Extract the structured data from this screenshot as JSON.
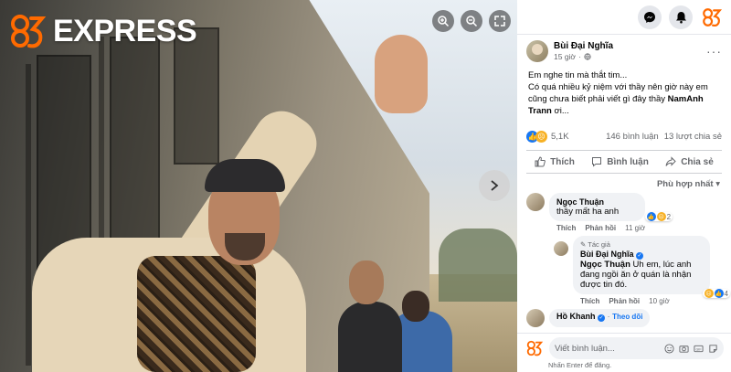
{
  "brand": {
    "name": "EXPRESS",
    "mark": "35",
    "mark_color": "#ff6a00"
  },
  "viewer": {
    "controls": [
      "zoom-in-icon",
      "zoom-out-icon",
      "fullscreen-icon"
    ],
    "next_icon": "chevron-right-icon"
  },
  "topbar": {
    "icons": [
      "messenger-icon",
      "bell-icon",
      "35-logo"
    ]
  },
  "post": {
    "author": "Bùi Đại Nghĩa",
    "time": "15 giờ",
    "privacy_icon": "globe-icon",
    "text_line1": "Em nghe tin mà thắt tim...",
    "text_line2": "Có quá nhiều kỷ niệm với thầy nên giờ này em cũng chưa biết phải viết gì đây thầy",
    "text_tag": "NamAnh Trann",
    "text_tail": "ơi...",
    "reactions_count": "5,1K",
    "comments_count": "146 bình luận",
    "shares_count": "13 lượt chia sẻ"
  },
  "actions": {
    "like": "Thích",
    "comment": "Bình luận",
    "share": "Chia sẻ"
  },
  "sort_label": "Phù hợp nhất",
  "comments": [
    {
      "name": "Ngọc Thuận",
      "text": "thầy mất ha anh",
      "react_count": "2",
      "like": "Thích",
      "reply": "Phản hồi",
      "time": "11 giờ"
    },
    {
      "author_badge": "Tác giả",
      "name": "Bùi Đại Nghĩa",
      "mention": "Ngọc Thuận",
      "text": "Uh em, lúc anh đang ngồi ăn ở quán là nhận được tin đó.",
      "react_count": "4",
      "like": "Thích",
      "reply": "Phản hồi",
      "time": "10 giờ"
    },
    {
      "name": "Hồ Khanh",
      "follow": "Theo dõi"
    }
  ],
  "composer": {
    "placeholder": "Viết bình luận...",
    "hint": "Nhấn Enter để đăng."
  },
  "colors": {
    "facebook_blue": "#1877f2",
    "brand_orange": "#ff6a00"
  }
}
